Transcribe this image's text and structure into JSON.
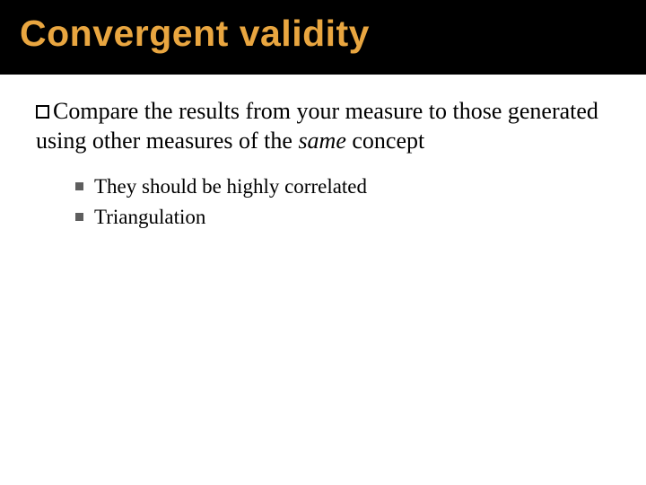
{
  "title": "Convergent validity",
  "main": {
    "pre": "Compare the results from your measure to those generated using other measures of the ",
    "italic": "same",
    "post": " concept"
  },
  "subs": [
    "They should be highly correlated",
    "Triangulation"
  ]
}
